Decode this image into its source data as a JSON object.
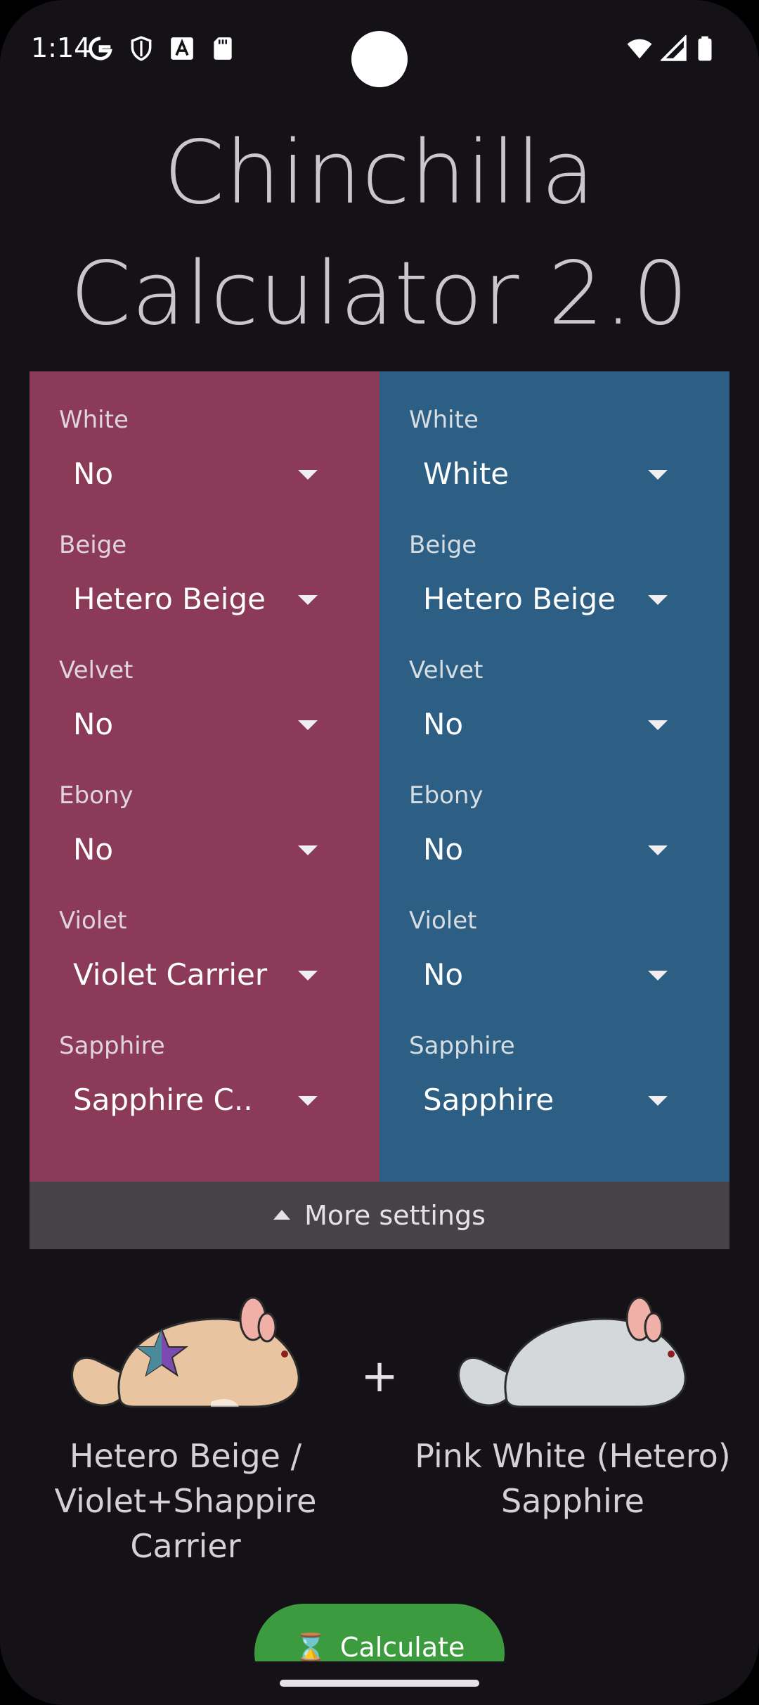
{
  "status_bar": {
    "time": "1:14"
  },
  "app": {
    "title_line1": "Chinchilla",
    "title_line2": "Calculator 2.0"
  },
  "left_panel": {
    "color": "#8b3a57",
    "fields": [
      {
        "label": "White",
        "value": "No"
      },
      {
        "label": "Beige",
        "value": "Hetero Beige"
      },
      {
        "label": "Velvet",
        "value": "No"
      },
      {
        "label": "Ebony",
        "value": "No"
      },
      {
        "label": "Violet",
        "value": "Violet Carrier"
      },
      {
        "label": "Sapphire",
        "value": "Sapphire C.."
      }
    ]
  },
  "right_panel": {
    "color": "#2d5f84",
    "fields": [
      {
        "label": "White",
        "value": "White"
      },
      {
        "label": "Beige",
        "value": "Hetero Beige"
      },
      {
        "label": "Velvet",
        "value": "No"
      },
      {
        "label": "Ebony",
        "value": "No"
      },
      {
        "label": "Violet",
        "value": "No"
      },
      {
        "label": "Sapphire",
        "value": "Sapphire"
      }
    ]
  },
  "more_settings": {
    "label": "More settings"
  },
  "result": {
    "plus": "+",
    "left": {
      "line1": "Hetero Beige /",
      "line2": "Violet+Shappire",
      "line3": "Carrier"
    },
    "right": {
      "line1": "Pink White (Hetero)",
      "line2": "Sapphire"
    }
  },
  "calculate": {
    "label": "Calculate",
    "color": "#3d9b3f"
  }
}
